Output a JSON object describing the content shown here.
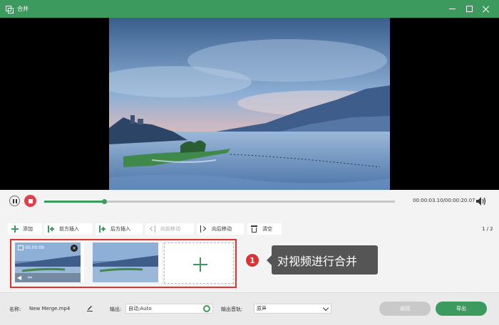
{
  "window": {
    "title": "合并",
    "icon": "merge-icon",
    "controls": [
      "minimize-icon",
      "maximize-icon",
      "close-icon"
    ]
  },
  "playback": {
    "progress_fraction": 0.17,
    "time": "00:00:03.10/00:00:20.07"
  },
  "toolbar": {
    "add": "添加",
    "insert_before": "前方插入",
    "insert_after": "后方插入",
    "move_forward": "向前移动",
    "move_backward": "向后移动",
    "clear": "清空",
    "page": "1 / 2"
  },
  "clips": [
    {
      "duration": "00:00:09",
      "selected": true
    },
    {
      "duration": "",
      "selected": false
    }
  ],
  "annotation": {
    "step": "1",
    "text": "对视频进行合并"
  },
  "footer": {
    "name_label": "名称:",
    "name_value": "New Merge.mp4",
    "output_label": "输出:",
    "output_value": "自动;Auto",
    "audio_label": "输出音轨:",
    "audio_value": "原声",
    "back": "返回",
    "export": "导出"
  },
  "colors": {
    "accent": "#3c9a5f",
    "highlight": "#e03131",
    "callout": "#555555"
  }
}
